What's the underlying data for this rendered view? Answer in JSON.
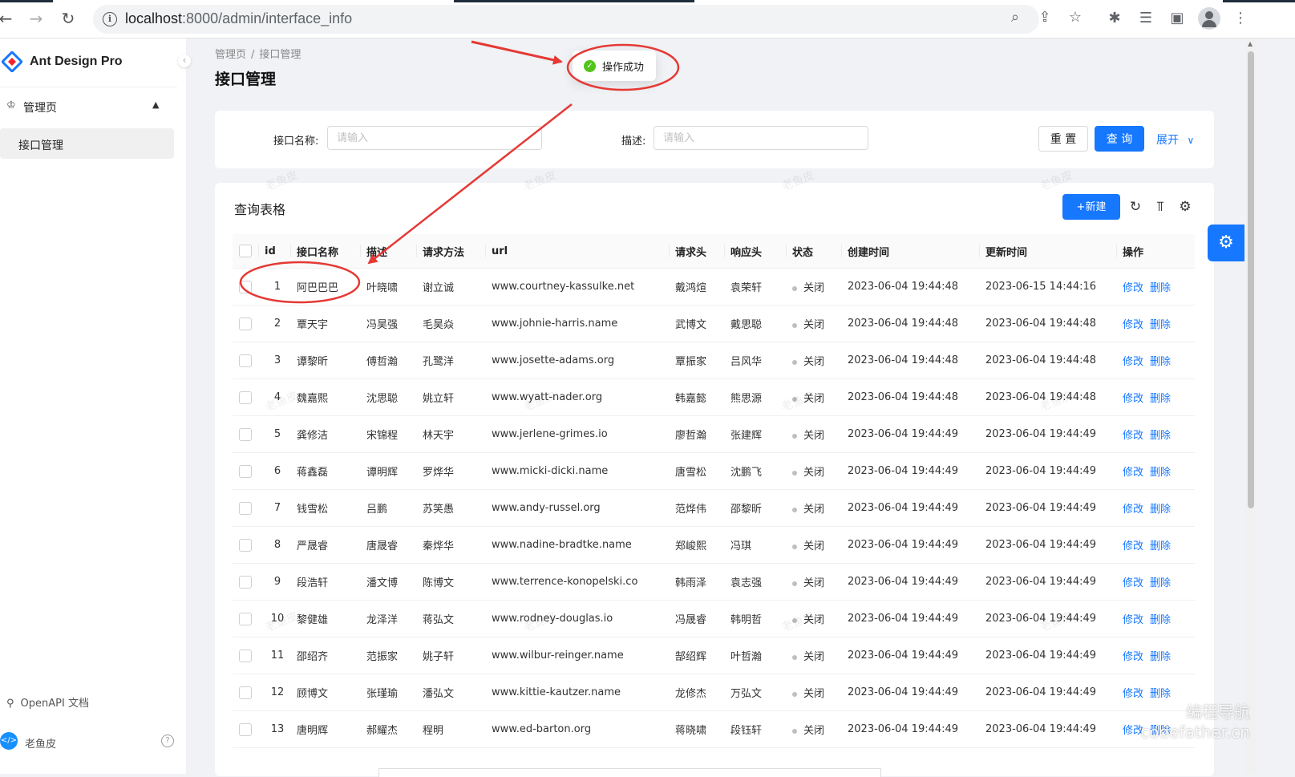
{
  "browser": {
    "url_host": "localhost",
    "url_path": ":8000/admin/interface_info"
  },
  "app": {
    "name": "Ant Design Pro",
    "menu_group": "管理页",
    "menu_active": "接口管理",
    "footer_link": "OpenAPI 文档",
    "user_name": "老鱼皮"
  },
  "breadcrumb": [
    "管理页",
    "接口管理"
  ],
  "page_title": "接口管理",
  "toast": {
    "message": "操作成功"
  },
  "search": {
    "name_label": "接口名称:",
    "name_placeholder": "请输入",
    "desc_label": "描述:",
    "desc_placeholder": "请输入",
    "reset": "重 置",
    "query": "查 询",
    "expand": "展开"
  },
  "table": {
    "title": "查询表格",
    "new_button": "+新建",
    "columns": [
      "id",
      "接口名称",
      "描述",
      "请求方法",
      "url",
      "请求头",
      "响应头",
      "状态",
      "创建时间",
      "更新时间",
      "操作"
    ],
    "edit_label": "修改",
    "delete_label": "删除",
    "rows": [
      {
        "id": "1",
        "name": "阿巴巴巴",
        "desc": "叶晓啸",
        "method": "谢立诚",
        "url": "www.courtney-kassulke.net",
        "req": "戴鸿煊",
        "res": "袁荣轩",
        "status": "关闭",
        "created": "2023-06-04 19:44:48",
        "updated": "2023-06-15 14:44:16"
      },
      {
        "id": "2",
        "name": "覃天宇",
        "desc": "冯昊强",
        "method": "毛昊焱",
        "url": "www.johnie-harris.name",
        "req": "武博文",
        "res": "戴思聪",
        "status": "关闭",
        "created": "2023-06-04 19:44:48",
        "updated": "2023-06-04 19:44:48"
      },
      {
        "id": "3",
        "name": "谭黎昕",
        "desc": "傅哲瀚",
        "method": "孔鹭洋",
        "url": "www.josette-adams.org",
        "req": "覃振家",
        "res": "吕风华",
        "status": "关闭",
        "created": "2023-06-04 19:44:48",
        "updated": "2023-06-04 19:44:48"
      },
      {
        "id": "4",
        "name": "魏嘉熙",
        "desc": "沈思聪",
        "method": "姚立轩",
        "url": "www.wyatt-nader.org",
        "req": "韩嘉懿",
        "res": "熊思源",
        "status": "关闭",
        "created": "2023-06-04 19:44:48",
        "updated": "2023-06-04 19:44:48"
      },
      {
        "id": "5",
        "name": "龚修洁",
        "desc": "宋锦程",
        "method": "林天宇",
        "url": "www.jerlene-grimes.io",
        "req": "廖哲瀚",
        "res": "张建辉",
        "status": "关闭",
        "created": "2023-06-04 19:44:49",
        "updated": "2023-06-04 19:44:49"
      },
      {
        "id": "6",
        "name": "蒋鑫磊",
        "desc": "谭明辉",
        "method": "罗烨华",
        "url": "www.micki-dicki.name",
        "req": "唐雪松",
        "res": "沈鹏飞",
        "status": "关闭",
        "created": "2023-06-04 19:44:49",
        "updated": "2023-06-04 19:44:49"
      },
      {
        "id": "7",
        "name": "钱雪松",
        "desc": "吕鹏",
        "method": "苏笑愚",
        "url": "www.andy-russel.org",
        "req": "范烨伟",
        "res": "邵黎昕",
        "status": "关闭",
        "created": "2023-06-04 19:44:49",
        "updated": "2023-06-04 19:44:49"
      },
      {
        "id": "8",
        "name": "严晟睿",
        "desc": "唐晟睿",
        "method": "秦烨华",
        "url": "www.nadine-bradtke.name",
        "req": "郑峻熙",
        "res": "冯琪",
        "status": "关闭",
        "created": "2023-06-04 19:44:49",
        "updated": "2023-06-04 19:44:49"
      },
      {
        "id": "9",
        "name": "段浩轩",
        "desc": "潘文博",
        "method": "陈博文",
        "url": "www.terrence-konopelski.co",
        "req": "韩雨泽",
        "res": "袁志强",
        "status": "关闭",
        "created": "2023-06-04 19:44:49",
        "updated": "2023-06-04 19:44:49"
      },
      {
        "id": "10",
        "name": "黎健雄",
        "desc": "龙泽洋",
        "method": "蒋弘文",
        "url": "www.rodney-douglas.io",
        "req": "冯晟睿",
        "res": "韩明哲",
        "status": "关闭",
        "created": "2023-06-04 19:44:49",
        "updated": "2023-06-04 19:44:49"
      },
      {
        "id": "11",
        "name": "邵绍齐",
        "desc": "范振家",
        "method": "姚子轩",
        "url": "www.wilbur-reinger.name",
        "req": "郜绍辉",
        "res": "叶哲瀚",
        "status": "关闭",
        "created": "2023-06-04 19:44:49",
        "updated": "2023-06-04 19:44:49"
      },
      {
        "id": "12",
        "name": "顾博文",
        "desc": "张瑾瑜",
        "method": "潘弘文",
        "url": "www.kittie-kautzer.name",
        "req": "龙修杰",
        "res": "万弘文",
        "status": "关闭",
        "created": "2023-06-04 19:44:49",
        "updated": "2023-06-04 19:44:49"
      },
      {
        "id": "13",
        "name": "唐明辉",
        "desc": "郝耀杰",
        "method": "程明",
        "url": "www.ed-barton.org",
        "req": "蒋晓啸",
        "res": "段钰轩",
        "status": "关闭",
        "created": "2023-06-04 19:44:49",
        "updated": "2023-06-04 19:44:49"
      }
    ]
  },
  "watermark": "老鱼皮",
  "corner_watermark": [
    "编程导航",
    "codefather.cn"
  ],
  "colors": {
    "primary": "#1677ff",
    "success": "#52c41a",
    "annotation": "#e53935"
  }
}
